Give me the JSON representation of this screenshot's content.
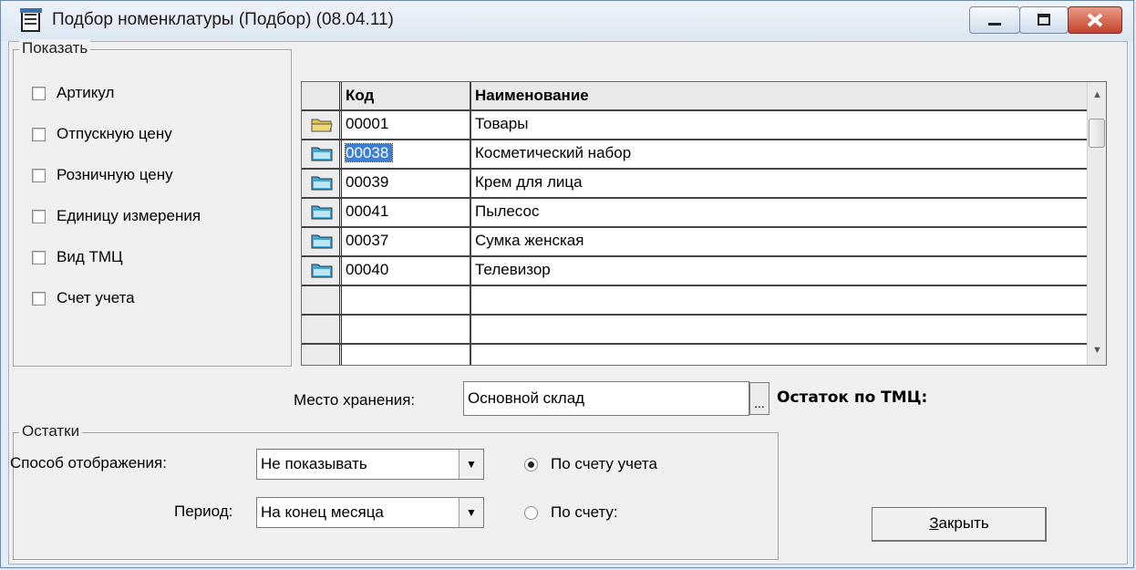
{
  "window": {
    "title": "Подбор номенклатуры (Подбор) (08.04.11)"
  },
  "show_group": {
    "title": "Показать",
    "options": [
      {
        "label": "Артикул",
        "checked": false
      },
      {
        "label": "Отпускную цену",
        "checked": false
      },
      {
        "label": "Розничную цену",
        "checked": false
      },
      {
        "label": "Единицу измерения",
        "checked": false
      },
      {
        "label": "Вид ТМЦ",
        "checked": false
      },
      {
        "label": "Счет учета",
        "checked": false
      }
    ]
  },
  "grid": {
    "columns": {
      "code": "Код",
      "name": "Наименование"
    },
    "rows": [
      {
        "code": "00001",
        "name": "Товары",
        "icon": "folder-open-icon"
      },
      {
        "code": "00038",
        "name": "Косметический набор",
        "icon": "folder-icon",
        "selected": true
      },
      {
        "code": "00039",
        "name": "Крем для лица",
        "icon": "folder-icon"
      },
      {
        "code": "00041",
        "name": "Пылесос",
        "icon": "folder-icon"
      },
      {
        "code": "00037",
        "name": "Сумка женская",
        "icon": "folder-icon"
      },
      {
        "code": "00040",
        "name": "Телевизор",
        "icon": "folder-icon"
      }
    ]
  },
  "storage": {
    "label": "Место хранения:",
    "value": "Основной склад",
    "button": "..."
  },
  "stock_label": "Остаток по ТМЦ:",
  "remains_group": {
    "title": "Остатки",
    "mode_label": "Способ отображения:",
    "mode_value": "Не показывать",
    "period_label": "Период:",
    "period_value": "На конец месяца",
    "radio_account": "По счету учета",
    "radio_other": "По счету:"
  },
  "close_button": {
    "underlined": "З",
    "rest": "акрыть"
  },
  "colors": {
    "selection": "#3b7fd6",
    "folder": "#3fa7d6",
    "folder_open": "#e2c24a"
  }
}
